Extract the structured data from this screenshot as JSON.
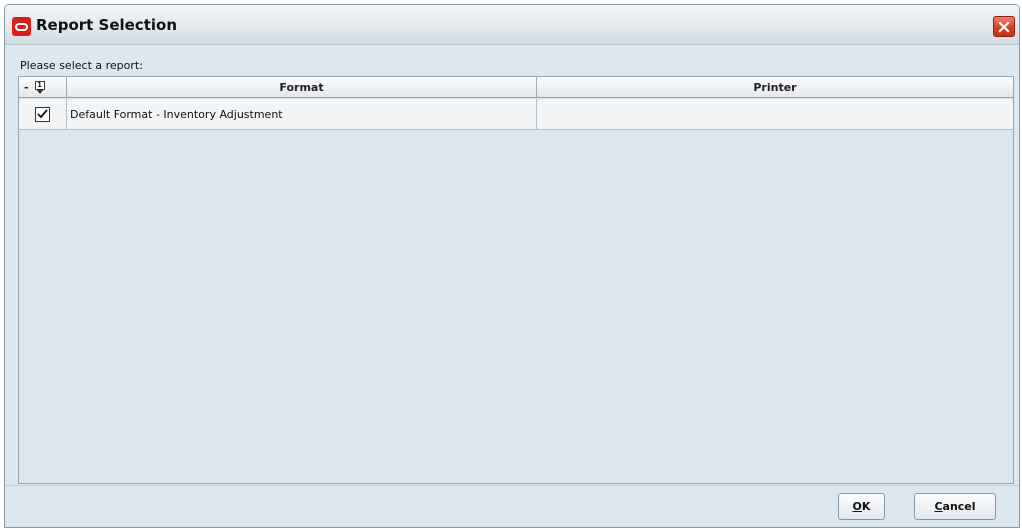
{
  "window": {
    "title": "Report Selection",
    "icon": "oracle-logo-icon",
    "close_icon": "close-icon"
  },
  "prompt": "Please select a report:",
  "grid": {
    "select_header_label": "-",
    "sort_indicator": "1",
    "columns": [
      "Format",
      "Printer"
    ],
    "rows": [
      {
        "checked": true,
        "format": "Default Format - Inventory Adjustment",
        "printer": ""
      }
    ]
  },
  "buttons": {
    "ok_mnemonic": "O",
    "ok_rest": "K",
    "cancel_mnemonic": "C",
    "cancel_rest": "ancel"
  },
  "colors": {
    "window_bg": "#dde7ef",
    "close_button": "#d2401f",
    "oracle_red": "#d8201a"
  }
}
